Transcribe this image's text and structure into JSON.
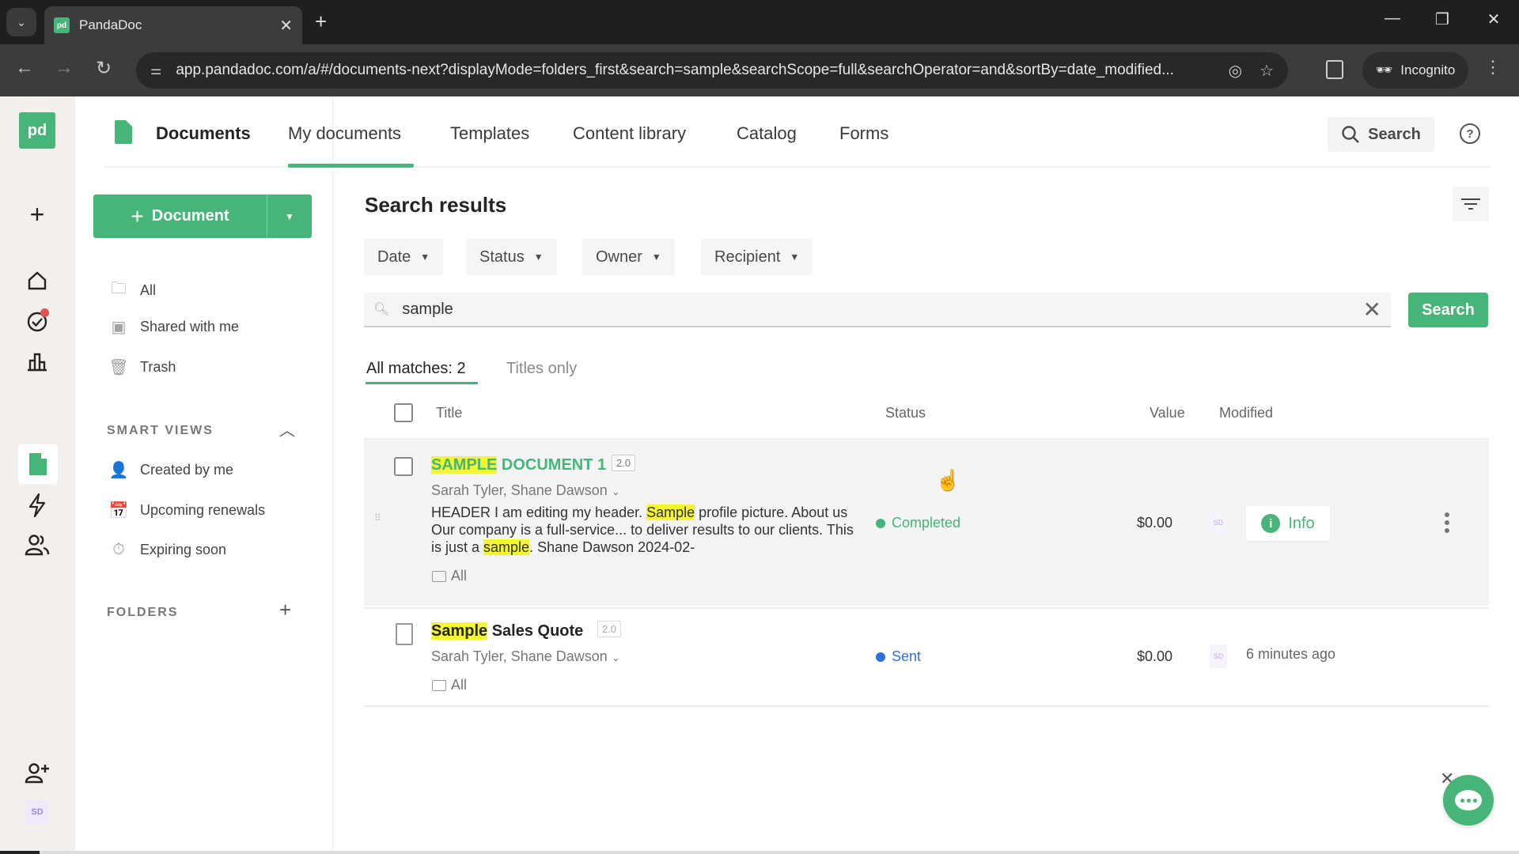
{
  "browser": {
    "tab_title": "PandaDoc",
    "tab_favicon": "pd",
    "url": "app.pandadoc.com/a/#/documents-next?displayMode=folders_first&search=sample&searchScope=full&searchOperator=and&sortBy=date_modified...",
    "profile_label": "Incognito"
  },
  "rail": {
    "logo": "pd",
    "avatar_initials": "SD"
  },
  "header": {
    "title": "Documents",
    "tabs": [
      "My documents",
      "Templates",
      "Content library",
      "Catalog",
      "Forms"
    ],
    "active_tab": "My documents",
    "search_label": "Search",
    "help_label": "?"
  },
  "leftnav": {
    "new_document_label": "Document",
    "items": [
      {
        "label": "All",
        "icon": "folder-icon"
      },
      {
        "label": "Shared with me",
        "icon": "shared-folder-icon"
      },
      {
        "label": "Trash",
        "icon": "trash-icon"
      }
    ],
    "smart_views_title": "SMART VIEWS",
    "smart_views": [
      {
        "label": "Created by me",
        "icon": "person-icon"
      },
      {
        "label": "Upcoming renewals",
        "icon": "calendar-icon"
      },
      {
        "label": "Expiring soon",
        "icon": "stopwatch-icon"
      }
    ],
    "folders_title": "FOLDERS"
  },
  "main": {
    "title": "Search results",
    "filters": [
      "Date",
      "Status",
      "Owner",
      "Recipient"
    ],
    "search": {
      "value": "sample",
      "button_label": "Search"
    },
    "result_tabs": {
      "all": "All matches: 2",
      "titles": "Titles only"
    },
    "columns": {
      "title": "Title",
      "status": "Status",
      "value": "Value",
      "modified": "Modified"
    },
    "rows": [
      {
        "title_highlight": "SAMPLE",
        "title_rest": " DOCUMENT 1",
        "version": "2.0",
        "recipients": "Sarah Tyler, Shane Dawson",
        "snippet_1": "HEADER I am editing my header. ",
        "snippet_hl_1": "Sample",
        "snippet_2": " profile picture. About us Our company is a full-service... to deliver results to our clients. This is just a ",
        "snippet_hl_2": "sample",
        "snippet_3": ". Shane Dawson 2024-02-",
        "folder": "All",
        "status": "Completed",
        "status_color": "#47b479",
        "value": "$0.00",
        "owner_initials": "SD",
        "action_label": "Info"
      },
      {
        "title_highlight": "Sample",
        "title_rest": " Sales Quote",
        "version": "2.0",
        "recipients": "Sarah Tyler, Shane Dawson",
        "folder": "All",
        "status": "Sent",
        "status_color": "#2f6fe0",
        "value": "$0.00",
        "owner_initials": "SD",
        "modified": "6 minutes ago"
      }
    ]
  },
  "colors": {
    "brand_green": "#47b479",
    "highlight_yellow": "#f3f630",
    "sent_blue": "#2f6fe0",
    "notification_red": "#e0544f"
  }
}
